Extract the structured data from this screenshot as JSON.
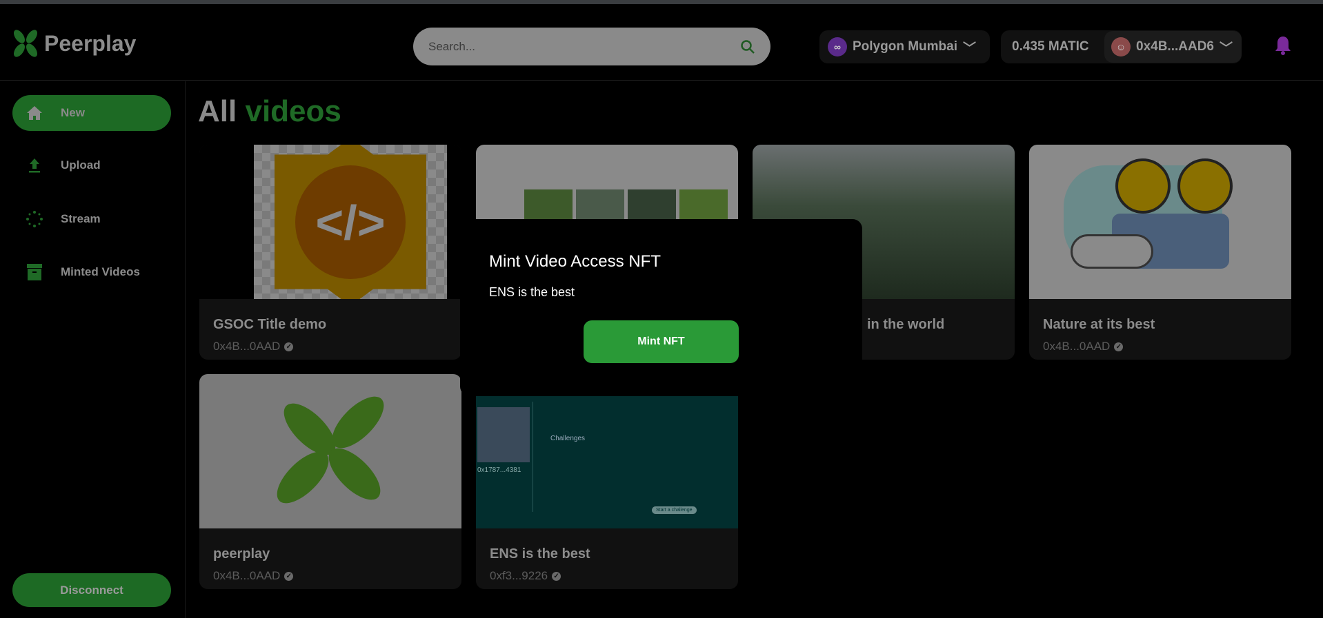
{
  "header": {
    "logo_text": "Peerplay",
    "search_placeholder": "Search...",
    "network": "Polygon Mumbai",
    "balance": "0.435 MATIC",
    "address": "0x4B...AAD6"
  },
  "sidebar": {
    "items": [
      {
        "label": "New",
        "icon": "home-icon",
        "active": true
      },
      {
        "label": "Upload",
        "icon": "upload-icon"
      },
      {
        "label": "Stream",
        "icon": "stream-icon"
      },
      {
        "label": "Minted Videos",
        "icon": "archive-icon"
      }
    ],
    "disconnect": "Disconnect"
  },
  "main": {
    "title_a": "All",
    "title_b": "videos",
    "cards": [
      {
        "title": "GSOC Title demo",
        "address": "0x4B...0AAD"
      },
      {
        "title": "",
        "address": ""
      },
      {
        "title": "in the world",
        "address": ""
      },
      {
        "title": "Nature at its best",
        "address": "0x4B...0AAD"
      },
      {
        "title": "peerplay",
        "address": "0x4B...0AAD"
      },
      {
        "title": "ENS is the best",
        "address": "0xf3...9226",
        "thumb_text": {
          "address": "0x1787...4381",
          "heading": "Challenges",
          "button": "Start a challenge"
        }
      }
    ]
  },
  "modal": {
    "title": "Mint Video Access NFT",
    "subtitle": "ENS is the best",
    "button": "Mint NFT"
  },
  "colors": {
    "accent": "#2a9a37",
    "sidebar_active": "#1d6a24"
  }
}
